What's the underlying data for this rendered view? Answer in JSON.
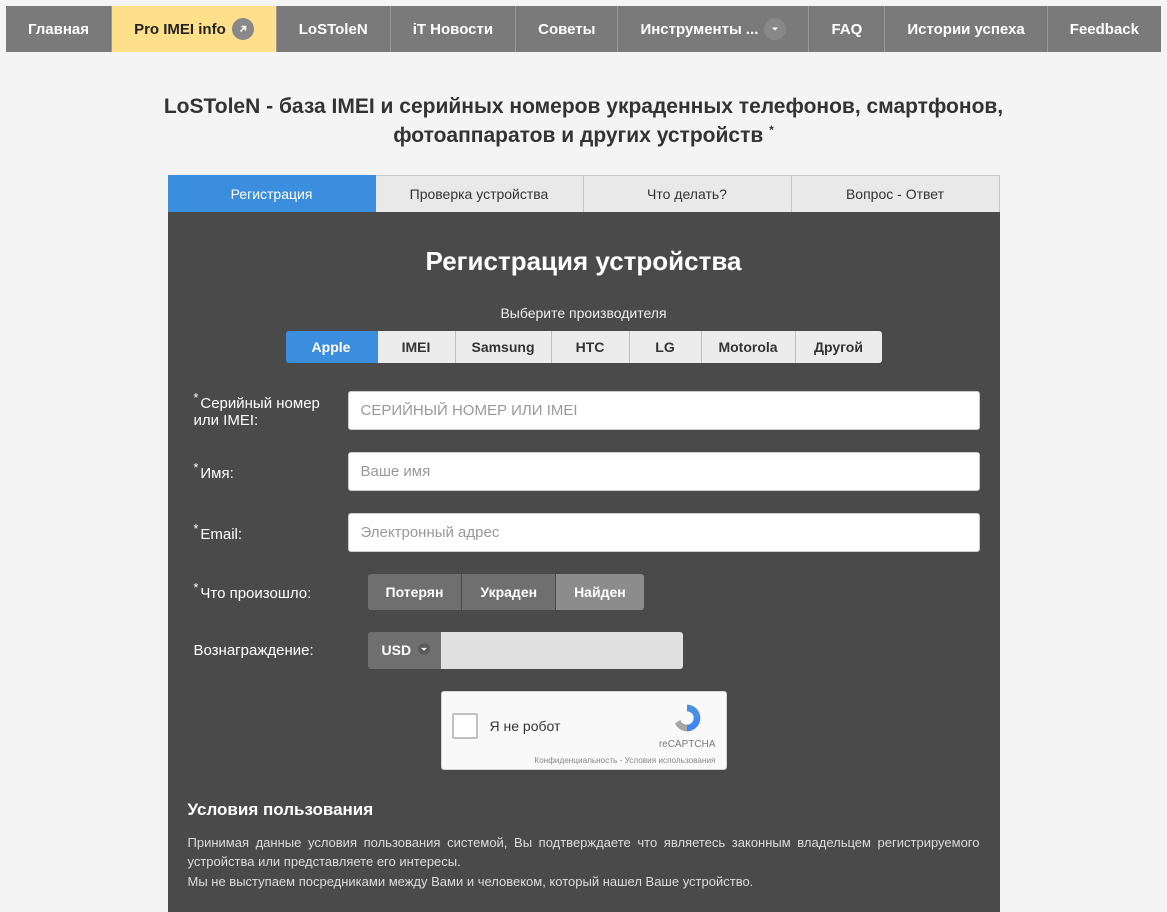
{
  "nav": {
    "items": [
      {
        "label": "Главная"
      },
      {
        "label": "Pro IMEI info",
        "active": true,
        "has_external": true
      },
      {
        "label": "LoSToleN"
      },
      {
        "label": "iT Новости"
      },
      {
        "label": "Советы"
      },
      {
        "label": "Инструменты ...",
        "has_dropdown": true
      },
      {
        "label": "FAQ"
      },
      {
        "label": "Истории успеха"
      },
      {
        "label": "Feedback"
      }
    ]
  },
  "main_heading": "LoSToleN - база IMEI и серийных номеров украденных телефонов, смартфонов, фотоаппаратов и других устройств",
  "tabs": [
    {
      "label": "Регистрация",
      "active": true
    },
    {
      "label": "Проверка устройства"
    },
    {
      "label": "Что делать?"
    },
    {
      "label": "Вопрос - Ответ"
    }
  ],
  "panel": {
    "title": "Регистрация устройства",
    "mfg_label": "Выберите производителя",
    "manufacturers": [
      {
        "label": "Apple",
        "active": true,
        "w": 92
      },
      {
        "label": "IMEI",
        "w": 78
      },
      {
        "label": "Samsung",
        "w": 96
      },
      {
        "label": "HTC",
        "w": 78
      },
      {
        "label": "LG",
        "w": 72
      },
      {
        "label": "Motorola",
        "w": 94
      },
      {
        "label": "Другой",
        "w": 86
      }
    ],
    "fields": {
      "serial": {
        "label": "Серийный номер или IMEI:",
        "req": true,
        "placeholder": "СЕРИЙНЫЙ НОМЕР ИЛИ IMEI"
      },
      "name": {
        "label": "Имя:",
        "req": true,
        "placeholder": "Ваше имя"
      },
      "email": {
        "label": "Email:",
        "req": true,
        "placeholder": "Электронный адрес"
      },
      "incident": {
        "label": "Что произошло:",
        "req": true
      },
      "reward": {
        "label": "Вознаграждение:",
        "req": false,
        "currency": "USD"
      }
    },
    "incident_options": [
      {
        "label": "Потерян"
      },
      {
        "label": "Украден"
      },
      {
        "label": "Найден",
        "light": true
      }
    ],
    "recaptcha": {
      "label": "Я не робот",
      "brand": "reCAPTCHA",
      "footer": "Конфиденциальность - Условия использования"
    },
    "terms": {
      "heading": "Условия пользования",
      "p1": "Принимая данные условия пользования системой, Вы подтверждаете что являетесь законным владельцем регистрируемого устройства или представляете его интересы.",
      "p2": "Мы не выступаем посредниками между Вами и человеком, который нашел Ваше устройство."
    }
  }
}
